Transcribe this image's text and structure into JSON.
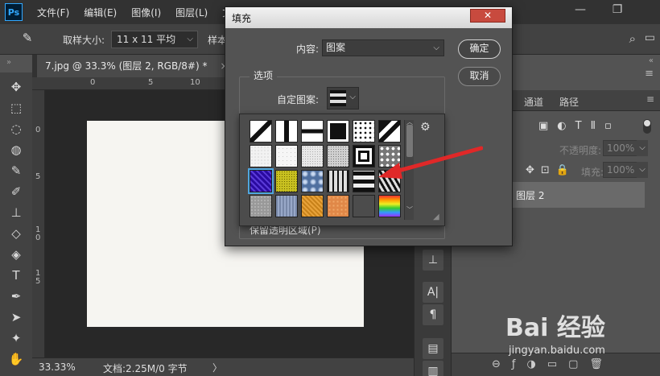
{
  "app": {
    "logo": "Ps",
    "menus": [
      "文件(F)",
      "编辑(E)",
      "图像(I)",
      "图层(L)",
      "文字"
    ],
    "window_controls": {
      "minimize": "—",
      "restore": "❐"
    }
  },
  "options_bar": {
    "sample_label": "取样大小:",
    "sample_value": "11 x 11 平均",
    "sample_label2": "样本"
  },
  "document": {
    "tab_title": "7.jpg @ 33.3% (图层 2, RGB/8#) *",
    "tab_close": "×",
    "ruler_top_ticks": [
      "0",
      "5",
      "10"
    ],
    "ruler_left_ticks": [
      "0",
      "5",
      "1",
      "0",
      "1",
      "5"
    ]
  },
  "status_bar": {
    "zoom": "33.33%",
    "doc_info": "文档:2.25M/0 字节",
    "arrow": "〉"
  },
  "fill_dialog": {
    "title": "填充",
    "close_label": "✕",
    "content_label": "内容:",
    "content_value": "图案",
    "ok_label": "确定",
    "cancel_label": "取消",
    "options_legend": "选项",
    "custom_pattern_label": "自定图案:",
    "partial_row_text": "保留透明区域(P)"
  },
  "pattern_picker": {
    "selected_index": 12,
    "patterns": [
      {
        "name": "diagonal-line-1"
      },
      {
        "name": "vertical-bar"
      },
      {
        "name": "horizontal-bar"
      },
      {
        "name": "black-square"
      },
      {
        "name": "dots"
      },
      {
        "name": "diagonal-line-2"
      },
      {
        "name": "white-noise-1"
      },
      {
        "name": "white-noise-2"
      },
      {
        "name": "white-noise-3"
      },
      {
        "name": "gray-texture"
      },
      {
        "name": "concentric-squares"
      },
      {
        "name": "zebra-spots"
      },
      {
        "name": "purple-wave"
      },
      {
        "name": "yellow-noise"
      },
      {
        "name": "blue-bubbles"
      },
      {
        "name": "grid-bars"
      },
      {
        "name": "checker-blocks"
      },
      {
        "name": "zebra-stripes"
      },
      {
        "name": "gray-stone"
      },
      {
        "name": "blue-fabric"
      },
      {
        "name": "orange-burlap"
      },
      {
        "name": "orange-tile"
      },
      {
        "name": "white-grid"
      },
      {
        "name": "rainbow"
      }
    ]
  },
  "layers_panel": {
    "tabs": [
      "通道",
      "路径"
    ],
    "opacity_label": "不透明度:",
    "opacity_value": "100%",
    "fill_label": "填充:",
    "fill_value": "100%",
    "layer_name": "图层 2"
  },
  "watermark": {
    "text": "Bai 经验",
    "url": "jingyan.baidu.com"
  }
}
